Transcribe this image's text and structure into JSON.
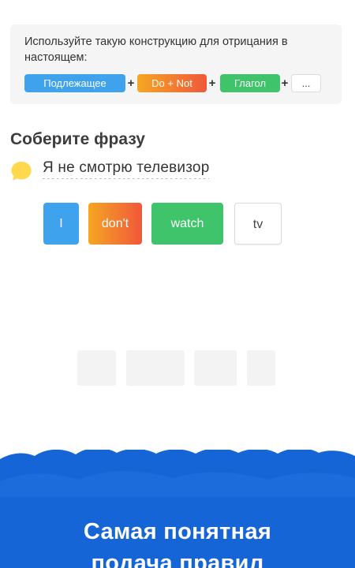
{
  "hint": {
    "text": "Используйте такую конструкцию для отрицания в настоящем:",
    "formula": [
      {
        "label": "Подлежащее",
        "color": "#3ea2ec"
      },
      {
        "label": "Do + Not",
        "color_from": "#f5a623",
        "color_to": "#f0583a"
      },
      {
        "label": "Глагол",
        "color": "#3fc36b"
      },
      {
        "label": "...",
        "color": "#ffffff"
      }
    ],
    "plus": "+"
  },
  "exercise": {
    "title": "Соберите фразу",
    "phrase": "Я не смотрю телевизор",
    "bubble_icon": "speech-bubble-icon",
    "bubble_color": "#ffd84d"
  },
  "words": [
    {
      "label": "I",
      "color": "#3ea2ec"
    },
    {
      "label": "don't",
      "color_from": "#f5a623",
      "color_to": "#f0583a"
    },
    {
      "label": "watch",
      "color": "#3fc36b"
    },
    {
      "label": "tv",
      "color": "#ffffff"
    }
  ],
  "answer_slots": 4,
  "promo": {
    "line1": "Самая понятная",
    "line2": "подача правил",
    "color": "#1565d6"
  }
}
